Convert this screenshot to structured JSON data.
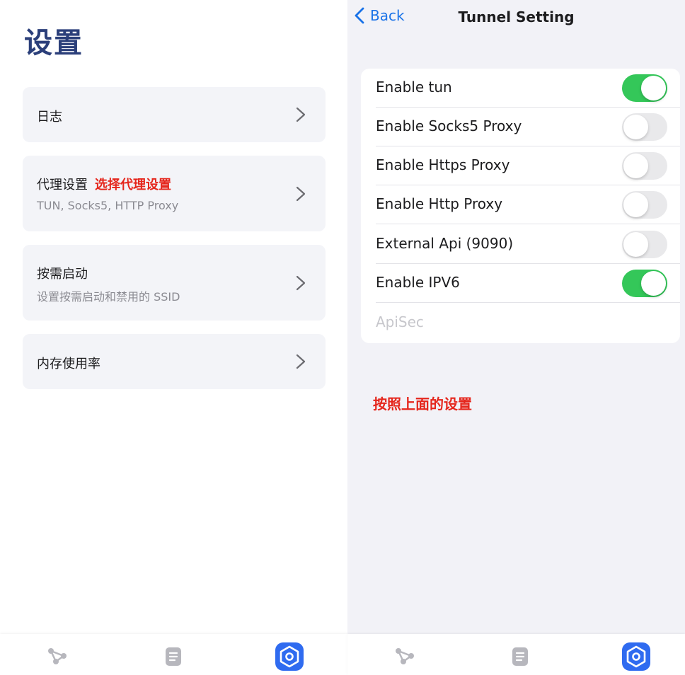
{
  "left": {
    "title": "设置",
    "cards": [
      {
        "title": "日志"
      },
      {
        "title": "代理设置",
        "annotation": "选择代理设置",
        "subtitle": "TUN, Socks5, HTTP Proxy"
      },
      {
        "title": "按需启动",
        "subtitle": "设置按需启动和禁用的 SSID"
      },
      {
        "title": "内存使用率"
      }
    ]
  },
  "right": {
    "back_label": "Back",
    "title": "Tunnel Setting",
    "rows": [
      {
        "label": "Enable tun",
        "on": true
      },
      {
        "label": "Enable Socks5 Proxy",
        "on": false
      },
      {
        "label": "Enable Https Proxy",
        "on": false
      },
      {
        "label": "Enable Http Proxy",
        "on": false
      },
      {
        "label": "External Api (9090)",
        "on": false
      },
      {
        "label": "Enable IPV6",
        "on": true
      }
    ],
    "apisec_placeholder": "ApiSec",
    "note": "按照上面的设置"
  },
  "tabbar": {
    "icons": [
      "proxy-nodes-icon",
      "document-icon",
      "settings-icon"
    ],
    "active_index": 2
  },
  "colors": {
    "accent_blue": "#1a73e8",
    "title_navy": "#2b3f7a",
    "toggle_on": "#34c759",
    "annotation_red": "#e5261c"
  }
}
